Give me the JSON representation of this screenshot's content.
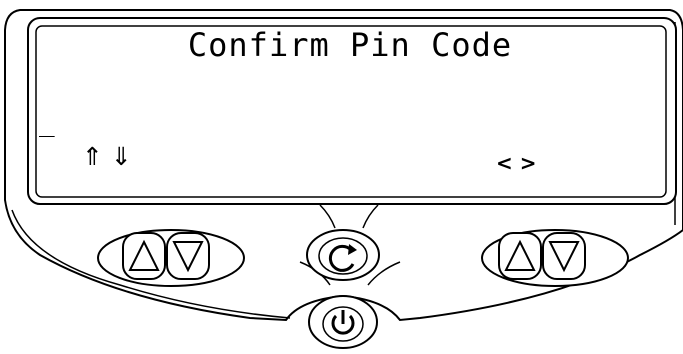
{
  "screen": {
    "title": "Confirm Pin Code",
    "cursor": "_",
    "scroll_arrows": "⇑ ⇓",
    "nav_arrows": "< >"
  },
  "buttons": {
    "left_up": "up-triangle-icon",
    "left_down": "down-triangle-icon",
    "center": "refresh-icon",
    "right_up": "up-triangle-icon",
    "right_down": "down-triangle-icon",
    "power": "power-icon"
  },
  "colors": {
    "outline": "#000000",
    "body": "#ffffff"
  }
}
